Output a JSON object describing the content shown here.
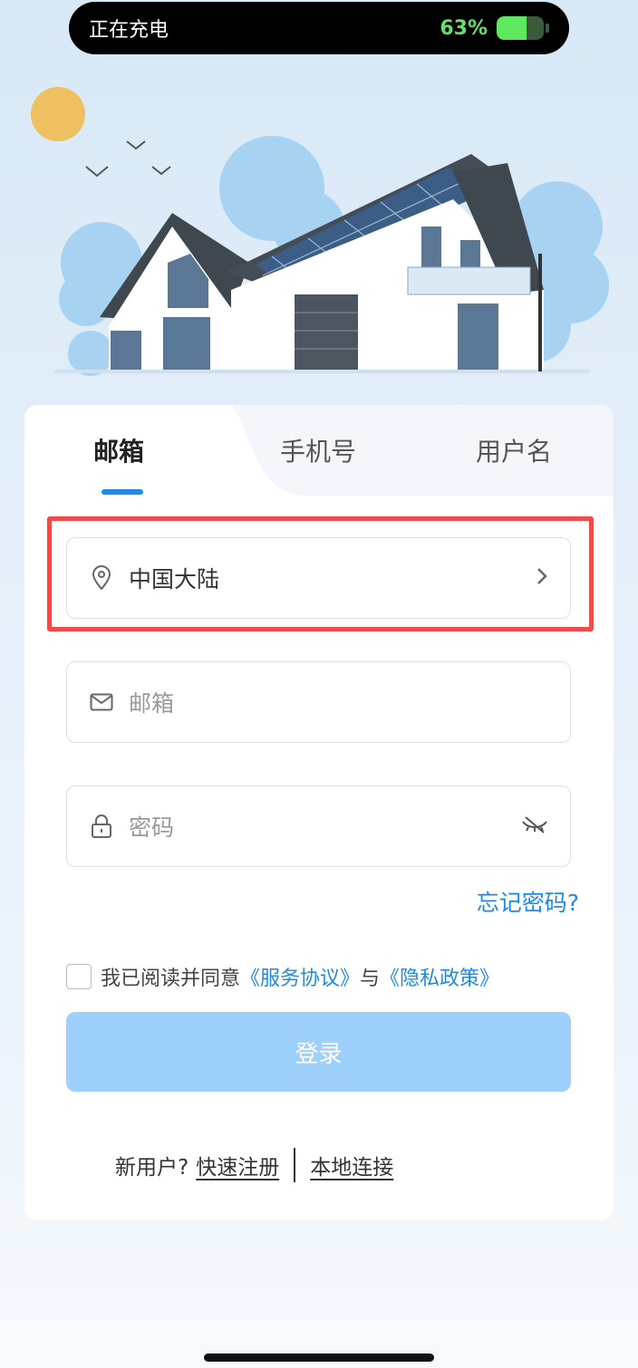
{
  "status_bar": {
    "charging_text": "正在充电",
    "battery_percent": "63%",
    "battery_level": 0.63,
    "battery_color": "#5fe85e"
  },
  "tabs": [
    {
      "label": "邮箱",
      "active": true
    },
    {
      "label": "手机号",
      "active": false
    },
    {
      "label": "用户名",
      "active": false
    }
  ],
  "region": {
    "value": "中国大陆",
    "icon": "location-pin-icon"
  },
  "email": {
    "placeholder": "邮箱",
    "icon": "mail-icon"
  },
  "password": {
    "placeholder": "密码",
    "icon": "lock-icon",
    "toggle_icon": "eye-off-icon"
  },
  "forgot_password": "忘记密码?",
  "agreement": {
    "prefix": "我已阅读并同意",
    "service": "《服务协议》",
    "joiner": "与",
    "privacy": "《隐私政策》",
    "checked": false
  },
  "login_button": "登录",
  "bottom": {
    "new_user": "新用户?",
    "register": "快速注册",
    "local_connect": "本地连接"
  },
  "colors": {
    "accent": "#1f8ae6",
    "highlight": "#ee4b4b",
    "button_disabled": "#9dd0fb"
  }
}
